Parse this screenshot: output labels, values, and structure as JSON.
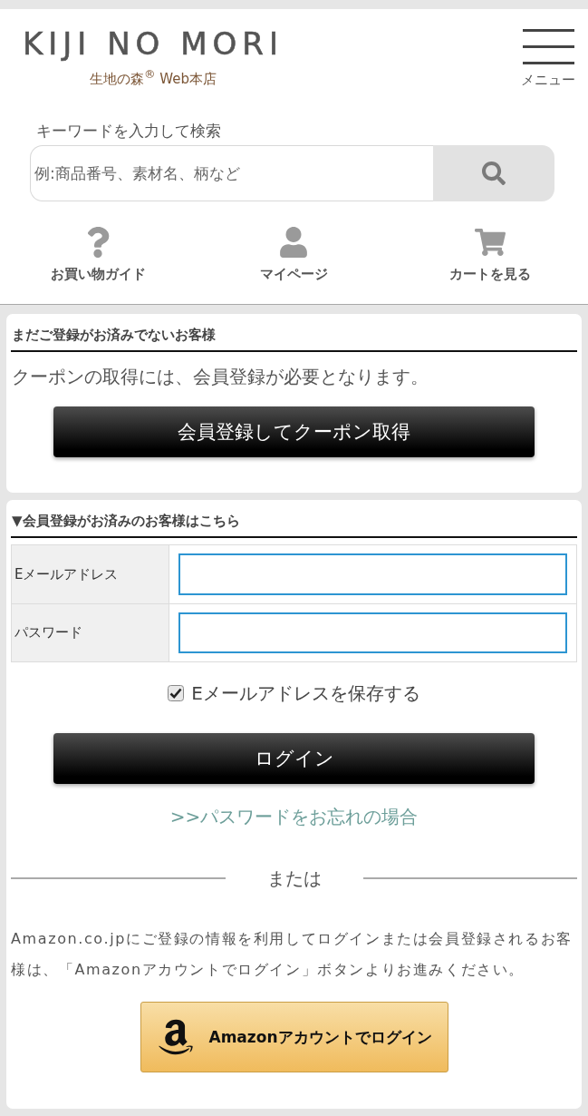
{
  "header": {
    "logo": "KIJI NO MORI",
    "subtitle": "生地の森$^{®}$ Web本店",
    "menu": "メニュー"
  },
  "search": {
    "label": "キーワードを入力して検索",
    "placeholder": "例:商品番号、素材名、柄など"
  },
  "nav": [
    {
      "kind": "guide",
      "label": "お買い物ガイド"
    },
    {
      "kind": "account",
      "label": "マイページ"
    },
    {
      "kind": "cart",
      "label": "カートを見る"
    }
  ],
  "register": {
    "heading": "まだご登録がお済みでないお客様",
    "message": "クーポンの取得には、会員登録が必要となります。",
    "button": "会員登録してクーポン取得"
  },
  "login": {
    "heading": "▼会員登録がお済みのお客様はこちら",
    "fields": [
      {
        "label": "Eメールアドレス"
      },
      {
        "label": "パスワード"
      }
    ],
    "remember": {
      "label": "Eメールアドレスを保存する",
      "checked": true
    },
    "button": "ログイン",
    "forgot_link": ">>パスワードをお忘れの場合",
    "divider": "または",
    "amazon_note": "Amazon.co.jpにご登録の情報を利用してログインまたは会員登録されるお客様は、「Amazonアカウントでログイン」ボタンよりお進みください。",
    "amazon_button": "Amazonアカウントでログイン"
  }
}
